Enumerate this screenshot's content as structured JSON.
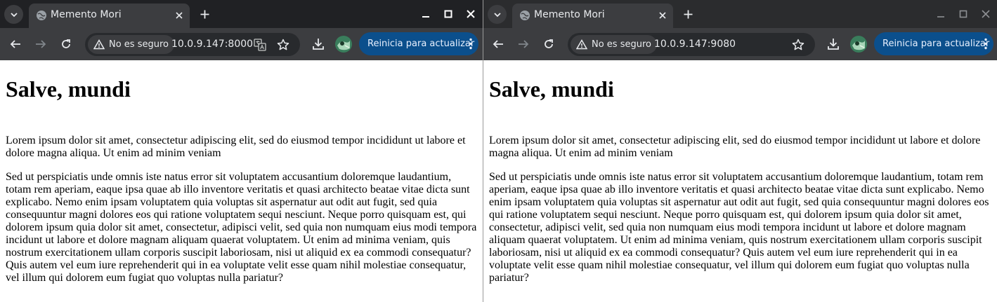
{
  "windows": [
    {
      "tab_title": "Memento Mori",
      "security_label": "No es seguro",
      "url": "10.0.9.147:8000",
      "update_label": "Reinicia para actualizar",
      "heading": "Salve, mundi",
      "paragraph1": "Lorem ipsum dolor sit amet, consectetur adipiscing elit, sed do eiusmod tempor incididunt ut labore et dolore magna aliqua. Ut enim ad minim veniam",
      "paragraph2": "Sed ut perspiciatis unde omnis iste natus error sit voluptatem accusantium doloremque laudantium, totam rem aperiam, eaque ipsa quae ab illo inventore veritatis et quasi architecto beatae vitae dicta sunt explicabo. Nemo enim ipsam voluptatem quia voluptas sit aspernatur aut odit aut fugit, sed quia consequuntur magni dolores eos qui ratione voluptatem sequi nesciunt. Neque porro quisquam est, qui dolorem ipsum quia dolor sit amet, consectetur, adipisci velit, sed quia non numquam eius modi tempora incidunt ut labore et dolore magnam aliquam quaerat voluptatem. Ut enim ad minima veniam, quis nostrum exercitationem ullam corporis suscipit laboriosam, nisi ut aliquid ex ea commodi consequatur? Quis autem vel eum iure reprehenderit qui in ea voluptate velit esse quam nihil molestiae consequatur, vel illum qui dolorem eum fugiat quo voluptas nulla pariatur?"
    },
    {
      "tab_title": "Memento Mori",
      "security_label": "No es seguro",
      "url": "10.0.9.147:9080",
      "update_label": "Reinicia para actualizar",
      "heading": "Salve, mundi",
      "paragraph1": "Lorem ipsum dolor sit amet, consectetur adipiscing elit, sed do eiusmod tempor incididunt ut labore et dolore magna aliqua. Ut enim ad minim veniam",
      "paragraph2": "Sed ut perspiciatis unde omnis iste natus error sit voluptatem accusantium doloremque laudantium, totam rem aperiam, eaque ipsa quae ab illo inventore veritatis et quasi architecto beatae vitae dicta sunt explicabo. Nemo enim ipsam voluptatem quia voluptas sit aspernatur aut odit aut fugit, sed quia consequuntur magni dolores eos qui ratione voluptatem sequi nesciunt. Neque porro quisquam est, qui dolorem ipsum quia dolor sit amet, consectetur, adipisci velit, sed quia non numquam eius modi tempora incidunt ut labore et dolore magnam aliquam quaerat voluptatem. Ut enim ad minima veniam, quis nostrum exercitationem ullam corporis suscipit laboriosam, nisi ut aliquid ex ea commodi consequatur? Quis autem vel eum iure reprehenderit qui in ea voluptate velit esse quam nihil molestiae consequatur, vel illum qui dolorem eum fugiat quo voluptas nulla pariatur?"
    }
  ],
  "icons": {
    "tab_search": "chevron-down-icon",
    "favicon": "globe-icon",
    "tab_close": "close-icon",
    "new_tab": "plus-icon",
    "minimize": "minimize-icon",
    "maximize": "maximize-icon",
    "close": "close-icon",
    "back": "back-arrow-icon",
    "forward": "forward-arrow-icon",
    "reload": "reload-icon",
    "warning": "warning-icon",
    "translate": "translate-icon",
    "bookmark": "star-icon",
    "download": "download-icon",
    "menu": "kebab-menu-icon"
  },
  "colors": {
    "update_button": "#0b4f8c",
    "toolbar": "#3c3d40",
    "titlebar_active": "#202124",
    "titlebar_inactive": "#2b2c2e"
  }
}
